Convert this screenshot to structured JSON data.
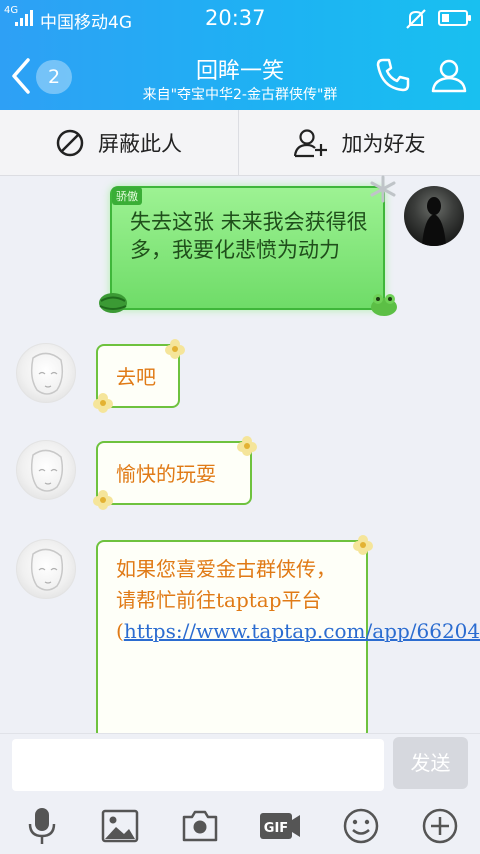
{
  "status_bar": {
    "network_small": "4G",
    "carrier": "中国移动4G",
    "time": "20:37"
  },
  "header": {
    "unread_count": "2",
    "title": "回眸一笑",
    "subtitle": "来自\"夺宝中华2-金古群侠传\"群"
  },
  "actions": {
    "block_label": "屏蔽此人",
    "add_friend_label": "加为好友"
  },
  "messages": [
    {
      "sender": "self",
      "tag": "骄傲",
      "text": "失去这张 未来我会获得很多，我要化悲愤为动力"
    },
    {
      "sender": "other",
      "text": "去吧"
    },
    {
      "sender": "other",
      "text": "愉快的玩耍"
    },
    {
      "sender": "other",
      "text_prefix": "如果您喜爱金古群侠传，请帮忙前往taptap平台(",
      "link": "https://www.taptap.com/app/66204"
    }
  ],
  "input": {
    "send_label": "发送"
  },
  "toolbar": [
    "mic-icon",
    "image-icon",
    "camera-icon",
    "gif-icon",
    "emoji-icon",
    "plus-icon"
  ],
  "colors": {
    "header_start": "#2ea0f5",
    "header_end": "#19c0f0",
    "self_bubble": "#7fe577",
    "other_text": "#e07a16",
    "link": "#2b6cd0"
  }
}
